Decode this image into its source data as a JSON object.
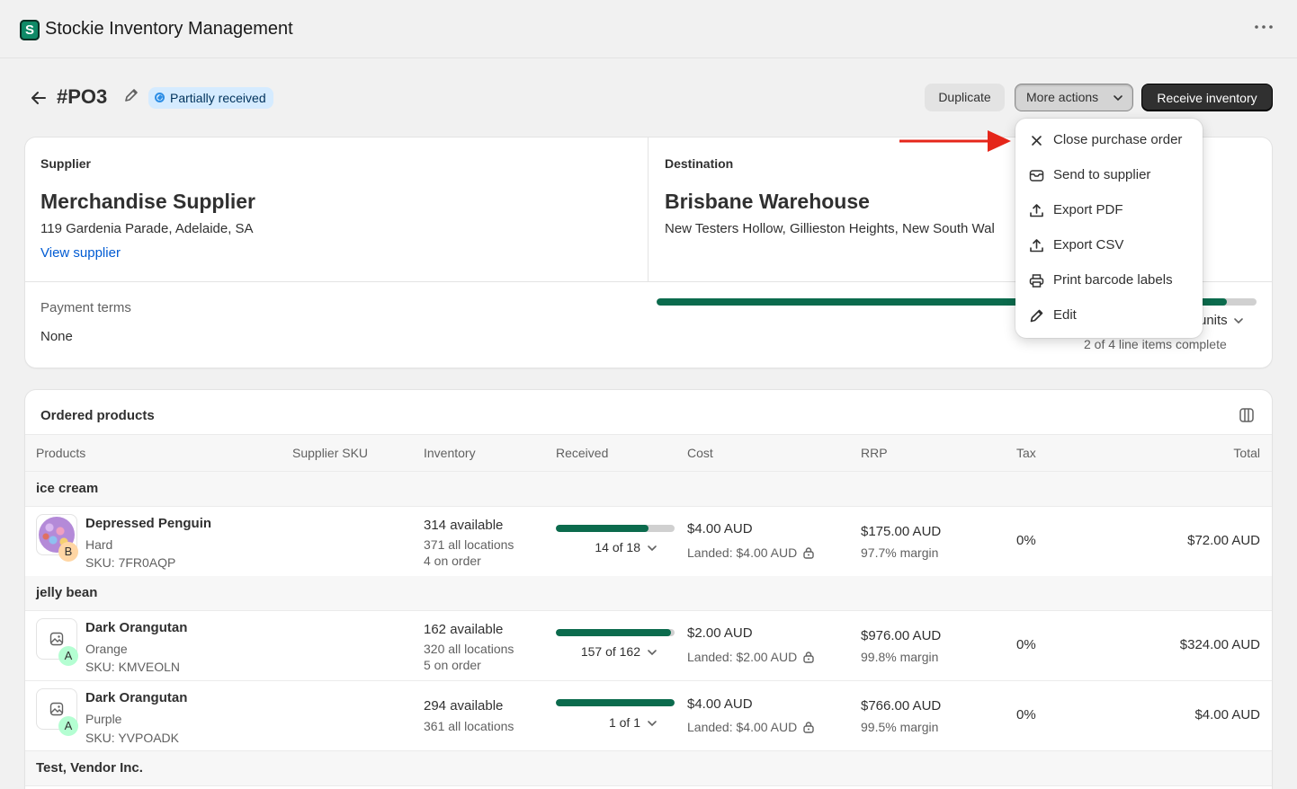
{
  "app": {
    "title": "Stockie Inventory Management",
    "logo_letter": "S"
  },
  "page": {
    "title": "#PO3",
    "status": "Partially received"
  },
  "actions": {
    "duplicate": "Duplicate",
    "more": "More actions",
    "receive": "Receive inventory"
  },
  "menu": {
    "items": [
      {
        "label": "Close purchase order",
        "icon": "close-icon"
      },
      {
        "label": "Send to supplier",
        "icon": "mail-icon"
      },
      {
        "label": "Export PDF",
        "icon": "upload-icon"
      },
      {
        "label": "Export CSV",
        "icon": "upload-icon"
      },
      {
        "label": "Print barcode labels",
        "icon": "printer-icon"
      },
      {
        "label": "Edit",
        "icon": "pencil-icon"
      }
    ]
  },
  "supplier": {
    "label": "Supplier",
    "name": "Merchandise Supplier",
    "address": "119 Gardenia Parade, Adelaide, SA",
    "link": "View supplier"
  },
  "destination": {
    "label": "Destination",
    "name": "Brisbane Warehouse",
    "address": "New Testers Hollow, Gillieston Heights, New South Wal"
  },
  "payment": {
    "label": "Payment terms",
    "value": "None"
  },
  "progress": {
    "fraction": 0.95,
    "units_label": "units",
    "items_complete": "2 of 4 line items complete"
  },
  "products": {
    "title": "Ordered products",
    "headers": {
      "products": "Products",
      "sku": "Supplier SKU",
      "inventory": "Inventory",
      "received": "Received",
      "cost": "Cost",
      "rrp": "RRP",
      "tax": "Tax",
      "total": "Total"
    },
    "groups": [
      {
        "name": "ice cream"
      },
      {
        "name": "jelly bean"
      },
      {
        "name": "Test, Vendor Inc."
      }
    ],
    "rows": [
      {
        "name": "Depressed Penguin",
        "variant": "Hard",
        "sku": "SKU: 7FR0AQP",
        "badge": "B",
        "badge_color": "#ffd6a4",
        "available": "314 available",
        "all_locations": "371 all locations",
        "on_order": "4 on order",
        "received_fraction": 0.78,
        "received_text": "14 of 18",
        "cost": "$4.00 AUD",
        "landed": "Landed: $4.00 AUD",
        "rrp": "$175.00 AUD",
        "margin": "97.7% margin",
        "tax": "0%",
        "total": "$72.00 AUD"
      },
      {
        "name": "Dark Orangutan",
        "variant": "Orange",
        "sku": "SKU: KMVEOLN",
        "badge": "A",
        "badge_color": "#b4fed2",
        "available": "162 available",
        "all_locations": "320 all locations",
        "on_order": "5 on order",
        "received_fraction": 0.97,
        "received_text": "157 of 162",
        "cost": "$2.00 AUD",
        "landed": "Landed: $2.00 AUD",
        "rrp": "$976.00 AUD",
        "margin": "99.8% margin",
        "tax": "0%",
        "total": "$324.00 AUD"
      },
      {
        "name": "Dark Orangutan",
        "variant": "Purple",
        "sku": "SKU: YVPOADK",
        "badge": "A",
        "badge_color": "#b4fed2",
        "available": "294 available",
        "all_locations": "361 all locations",
        "on_order": "",
        "received_fraction": 1.0,
        "received_text": "1 of 1",
        "cost": "$4.00 AUD",
        "landed": "Landed: $4.00 AUD",
        "rrp": "$766.00 AUD",
        "margin": "99.5% margin",
        "tax": "0%",
        "total": "$4.00 AUD"
      }
    ]
  },
  "colors": {
    "accent": "#0b6b4d",
    "badge_bg": "#d5ebff",
    "link": "#005bd3",
    "arrow": "#e5261a"
  }
}
